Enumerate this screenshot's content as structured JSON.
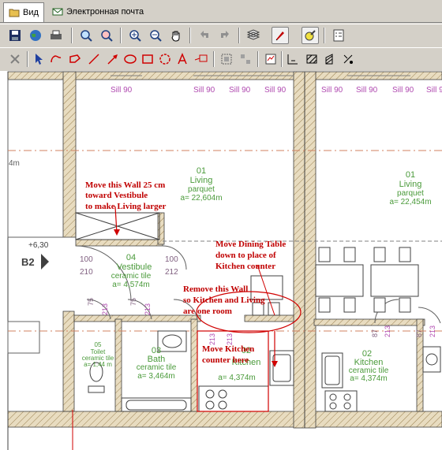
{
  "tabs": [
    {
      "label": "Вид",
      "icon": "folder-icon",
      "active": true
    },
    {
      "label": "Электронная почта",
      "icon": "mail-icon",
      "active": false
    }
  ],
  "toolbar1": [
    "save-icon",
    "globe-icon",
    "print-icon",
    "zoom-fit-icon",
    "zoom-window-icon",
    "zoom-in-icon",
    "zoom-out-icon",
    "pan-hand-icon",
    "undo-icon",
    "redo-icon",
    "layers-icon",
    "markup-pen-icon",
    "marker-icon",
    "properties-icon"
  ],
  "toolbar2": [
    "close-markup-icon",
    "select-arrow-icon",
    "cloud-icon",
    "freehand-icon",
    "line-icon",
    "arrow-icon",
    "ellipse-icon",
    "rectangle-icon",
    "cloud-rect-icon",
    "text-icon",
    "callout-icon",
    "group-icon",
    "ungroup-icon",
    "stamp-icon",
    "measure-icon",
    "hatch-icon",
    "hatch-2-icon",
    "scale-icon"
  ],
  "plan": {
    "sill_labels": [
      "Sill 90",
      "Sill 90",
      "Sill 90",
      "Sill 90",
      "Sill 90",
      "Sill 90",
      "Sill 90",
      "Sill 90",
      "Sill 90"
    ],
    "level_marker": "4m",
    "section_marker": "B2",
    "elevation": "+6,30",
    "door_dims": [
      "100",
      "210",
      "100",
      "212",
      "75",
      "213",
      "75",
      "213",
      "213",
      "213",
      "87",
      "213",
      "87",
      "213"
    ],
    "rooms": [
      {
        "num": "01",
        "name": "Living",
        "finish": "parquet",
        "area": "a= 22,604m"
      },
      {
        "num": "01",
        "name": "Living",
        "finish": "parquet",
        "area": "a= 22,454m"
      },
      {
        "num": "04",
        "name": "Vestibule",
        "finish": "ceramic tile",
        "area": "a= 4,574m"
      },
      {
        "num": "05",
        "name": "Toilet",
        "finish": "ceramic tile",
        "area": "a= 1,44 m"
      },
      {
        "num": "03",
        "name": "Bath",
        "finish": "ceramic tile",
        "area": "a= 3,464m"
      },
      {
        "num": "02",
        "name": "Kitchen",
        "finish": "",
        "area": "a= 4,374m"
      },
      {
        "num": "02",
        "name": "Kitchen",
        "finish": "ceramic tile",
        "area": "a= 4,374m"
      }
    ],
    "notes": {
      "note1": [
        "Move this Wall 25 cm",
        "toward Vestibule",
        "to make Living larger"
      ],
      "note2": [
        "Move Dining Table",
        "down to place of",
        "Kitchen counter"
      ],
      "note3": [
        "Remove this Wall",
        "so Kitchen and Living",
        "are one room"
      ],
      "note4": [
        "Move Kitchen",
        "counter here"
      ]
    }
  },
  "colors": {
    "markup": "#d00000",
    "room_text": "#4a9a3a",
    "sill": "#b04ab0",
    "wall_hatch": "#c8b48a"
  }
}
